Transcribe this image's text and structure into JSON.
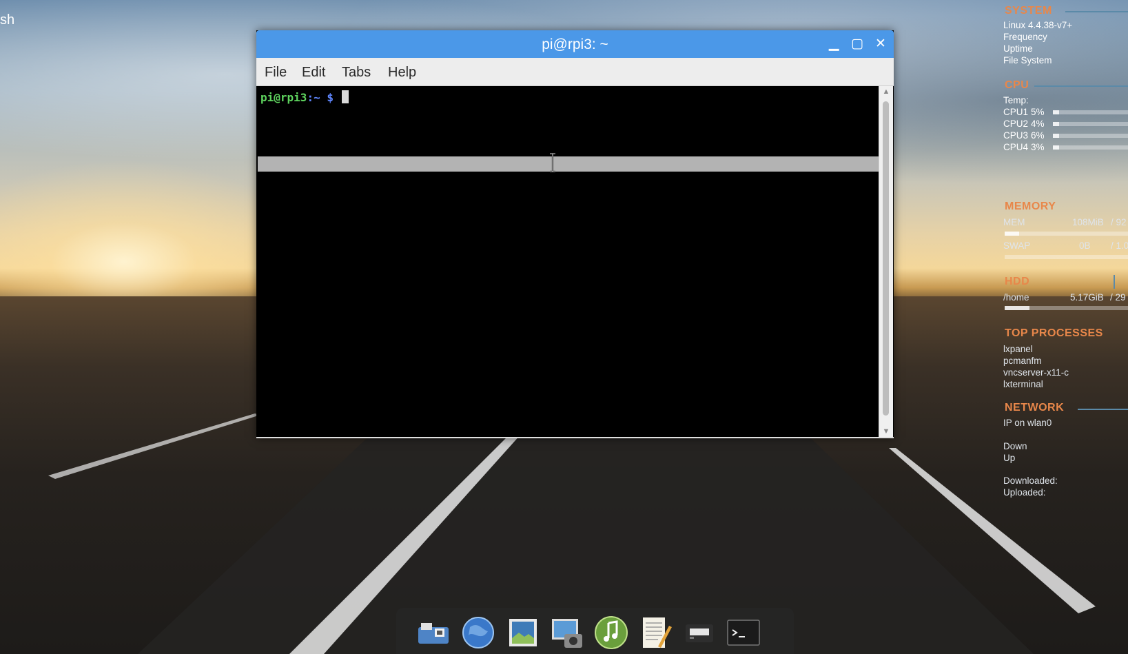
{
  "desktop": {
    "label_fragment": "sh"
  },
  "window": {
    "title": "pi@rpi3: ~",
    "controls": {
      "minimize": "_",
      "maximize": "□",
      "close": "✕"
    },
    "menu": [
      "File",
      "Edit",
      "Tabs",
      "Help"
    ],
    "terminal": {
      "prompt_user_host": "pi@rpi3",
      "prompt_path": ":~",
      "prompt_symbol": "$"
    }
  },
  "conky": {
    "system": {
      "heading": "SYSTEM",
      "lines": [
        "Linux 4.4.38-v7+",
        "Frequency",
        "Uptime",
        "File System"
      ]
    },
    "cpu": {
      "heading": "CPU",
      "temp_label": "Temp:",
      "cores": [
        {
          "label": "CPU1",
          "value": "5%",
          "level": 0.05
        },
        {
          "label": "CPU2",
          "value": "4%",
          "level": 0.04
        },
        {
          "label": "CPU3",
          "value": "6%",
          "level": 0.06
        },
        {
          "label": "CPU4",
          "value": "3%",
          "level": 0.03
        }
      ]
    },
    "memory": {
      "heading": "MEMORY",
      "mem_label": "MEM",
      "mem_value": "108MiB",
      "mem_total_fragment": "/ 92",
      "mem_level": 0.12,
      "swap_label": "SWAP",
      "swap_value": "0B",
      "swap_total_fragment": "/ 1.0",
      "swap_level": 0.0
    },
    "hdd": {
      "heading": "HDD",
      "mount": "/home",
      "used": "5.17GiB",
      "total_fragment": "/ 29",
      "level": 0.2
    },
    "top_processes": {
      "heading": "TOP PROCESSES",
      "items": [
        "lxpanel",
        "pcmanfm",
        "vncserver-x11-c",
        "lxterminal"
      ]
    },
    "network": {
      "heading": "NETWORK",
      "ip_label": "IP on wlan0",
      "down_label": "Down",
      "up_label": "Up",
      "downloaded_label": "Downloaded:",
      "uploaded_label": "Uploaded:"
    }
  },
  "dock": {
    "items": [
      "file-manager-icon",
      "web-browser-icon",
      "image-viewer-icon",
      "photos-icon",
      "music-player-icon",
      "text-editor-icon",
      "storage-icon",
      "terminal-icon"
    ]
  },
  "colors": {
    "titlebar": "#4b98e8",
    "conky_heading": "#e8874a",
    "prompt_user": "#5ed35e",
    "prompt_path": "#5f86ff"
  }
}
